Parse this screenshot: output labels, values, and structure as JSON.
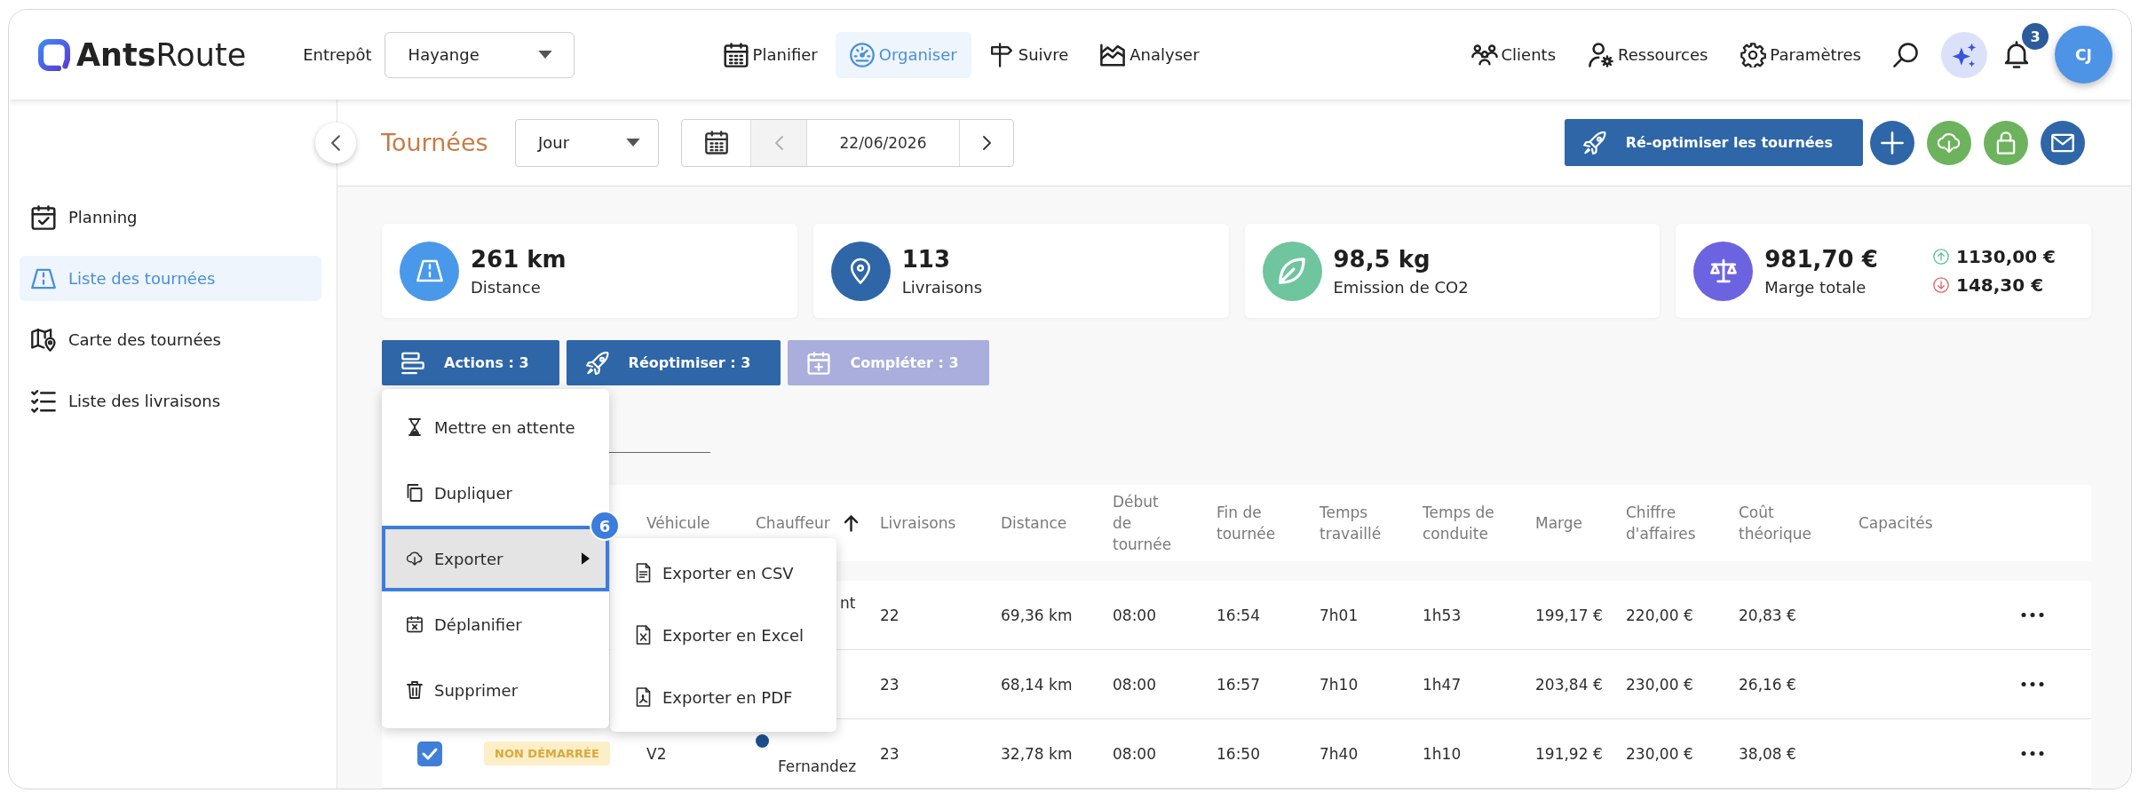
{
  "header": {
    "logo": "**Ants**Route",
    "warehouse": {
      "label": "Entrepôt",
      "value": "Hayange"
    },
    "nav": [
      {
        "label": "Planifier",
        "selected": false
      },
      {
        "label": "Organiser",
        "selected": true
      },
      {
        "label": "Suivre",
        "selected": false
      },
      {
        "label": "Analyser",
        "selected": false
      }
    ],
    "links": [
      {
        "label": "Clients"
      },
      {
        "label": "Ressources"
      },
      {
        "label": "Paramètres"
      }
    ],
    "notifications": "3",
    "avatar": "CJ"
  },
  "sidebar": {
    "items": [
      {
        "label": "Planning",
        "selected": false
      },
      {
        "label": "Liste des tournées",
        "selected": true
      },
      {
        "label": "Carte des tournées",
        "selected": false
      },
      {
        "label": "Liste des livraisons",
        "selected": false
      }
    ]
  },
  "toolbar": {
    "title": "Tournées",
    "period": "Jour",
    "date": "22/06/2026",
    "previous_disabled": true,
    "optimize_button": "Ré-optimiser les tournées",
    "round_buttons": [
      {
        "color": "#2e66a8"
      },
      {
        "color": "#6db35d"
      },
      {
        "color": "#6db35d"
      },
      {
        "color": "#2e66a8"
      }
    ]
  },
  "stats": [
    {
      "value": "261 km",
      "label": "Distance",
      "color": "#4a98e9"
    },
    {
      "value": "113",
      "label": "Livraisons",
      "color": "#2e66a8"
    },
    {
      "value": "98,5 kg",
      "label": "Emission de CO2",
      "color": "#6fc59d"
    },
    {
      "value": "981,70 €",
      "label": "Marge totale",
      "color": "#6c63e0",
      "gain": "1130,00 €",
      "loss": "148,30 €"
    }
  ],
  "actions": [
    {
      "label": "Actions : 3",
      "disabled": false
    },
    {
      "label": "Réoptimiser : 3",
      "disabled": false
    },
    {
      "label": "Compléter : 3",
      "disabled": true
    }
  ],
  "table": {
    "columns": [
      {
        "label": "Véhicule",
        "sorted": false
      },
      {
        "label": "Chauffeur",
        "sorted": true
      },
      {
        "label": "Livraisons",
        "sorted": false
      },
      {
        "label": "Distance",
        "sorted": false
      },
      {
        "label": "Début de tournée",
        "sorted": false
      },
      {
        "label": "Fin de tournée",
        "sorted": false
      },
      {
        "label": "Temps travaillé",
        "sorted": false
      },
      {
        "label": "Temps de conduite",
        "sorted": false
      },
      {
        "label": "Marge",
        "sorted": false
      },
      {
        "label": "Chiffre d'affaires",
        "sorted": false
      },
      {
        "label": "Coût théorique",
        "sorted": false
      },
      {
        "label": "Capacités",
        "sorted": false
      }
    ],
    "rows": [
      {
        "driver": {
          "line_1": "nt"
        },
        "deliveries": "22",
        "distance": "69,36 km",
        "start": "08:00",
        "end": "16:54",
        "worked": "7h01",
        "driving": "1h53",
        "margin": "199,17 €",
        "revenue": "220,00 €",
        "cost": "20,83 €"
      },
      {
        "deliveries": "23",
        "distance": "68,14 km",
        "start": "08:00",
        "end": "16:57",
        "worked": "7h10",
        "driving": "1h47",
        "margin": "203,84 €",
        "revenue": "230,00 €",
        "cost": "26,16 €"
      },
      {
        "checked": true,
        "status": {
          "label": "NON DÉMARRÉE",
          "color": "#fcefc7"
        },
        "vehicle": "V2",
        "driver": {
          "color": "#1e4e8c",
          "line_2": "Fernandez"
        },
        "deliveries": "23",
        "distance": "32,78 km",
        "start": "08:00",
        "end": "16:50",
        "worked": "7h40",
        "driving": "1h10",
        "margin": "191,92 €",
        "revenue": "230,00 €",
        "cost": "38,08 €"
      }
    ]
  },
  "menu": {
    "items": [
      {
        "label": "Mettre en attente",
        "kind": "action",
        "selected": false
      },
      {
        "label": "Dupliquer",
        "kind": "action",
        "selected": false
      },
      {
        "label": "Exporter",
        "kind": "submenu",
        "selected": true,
        "badge": "6"
      },
      {
        "label": "Déplanifier",
        "kind": "action",
        "selected": false
      },
      {
        "label": "Supprimer",
        "kind": "action",
        "selected": false
      }
    ],
    "submenu": [
      {
        "label": "Exporter en CSV"
      },
      {
        "label": "Exporter en Excel"
      },
      {
        "label": "Exporter en PDF"
      }
    ]
  }
}
